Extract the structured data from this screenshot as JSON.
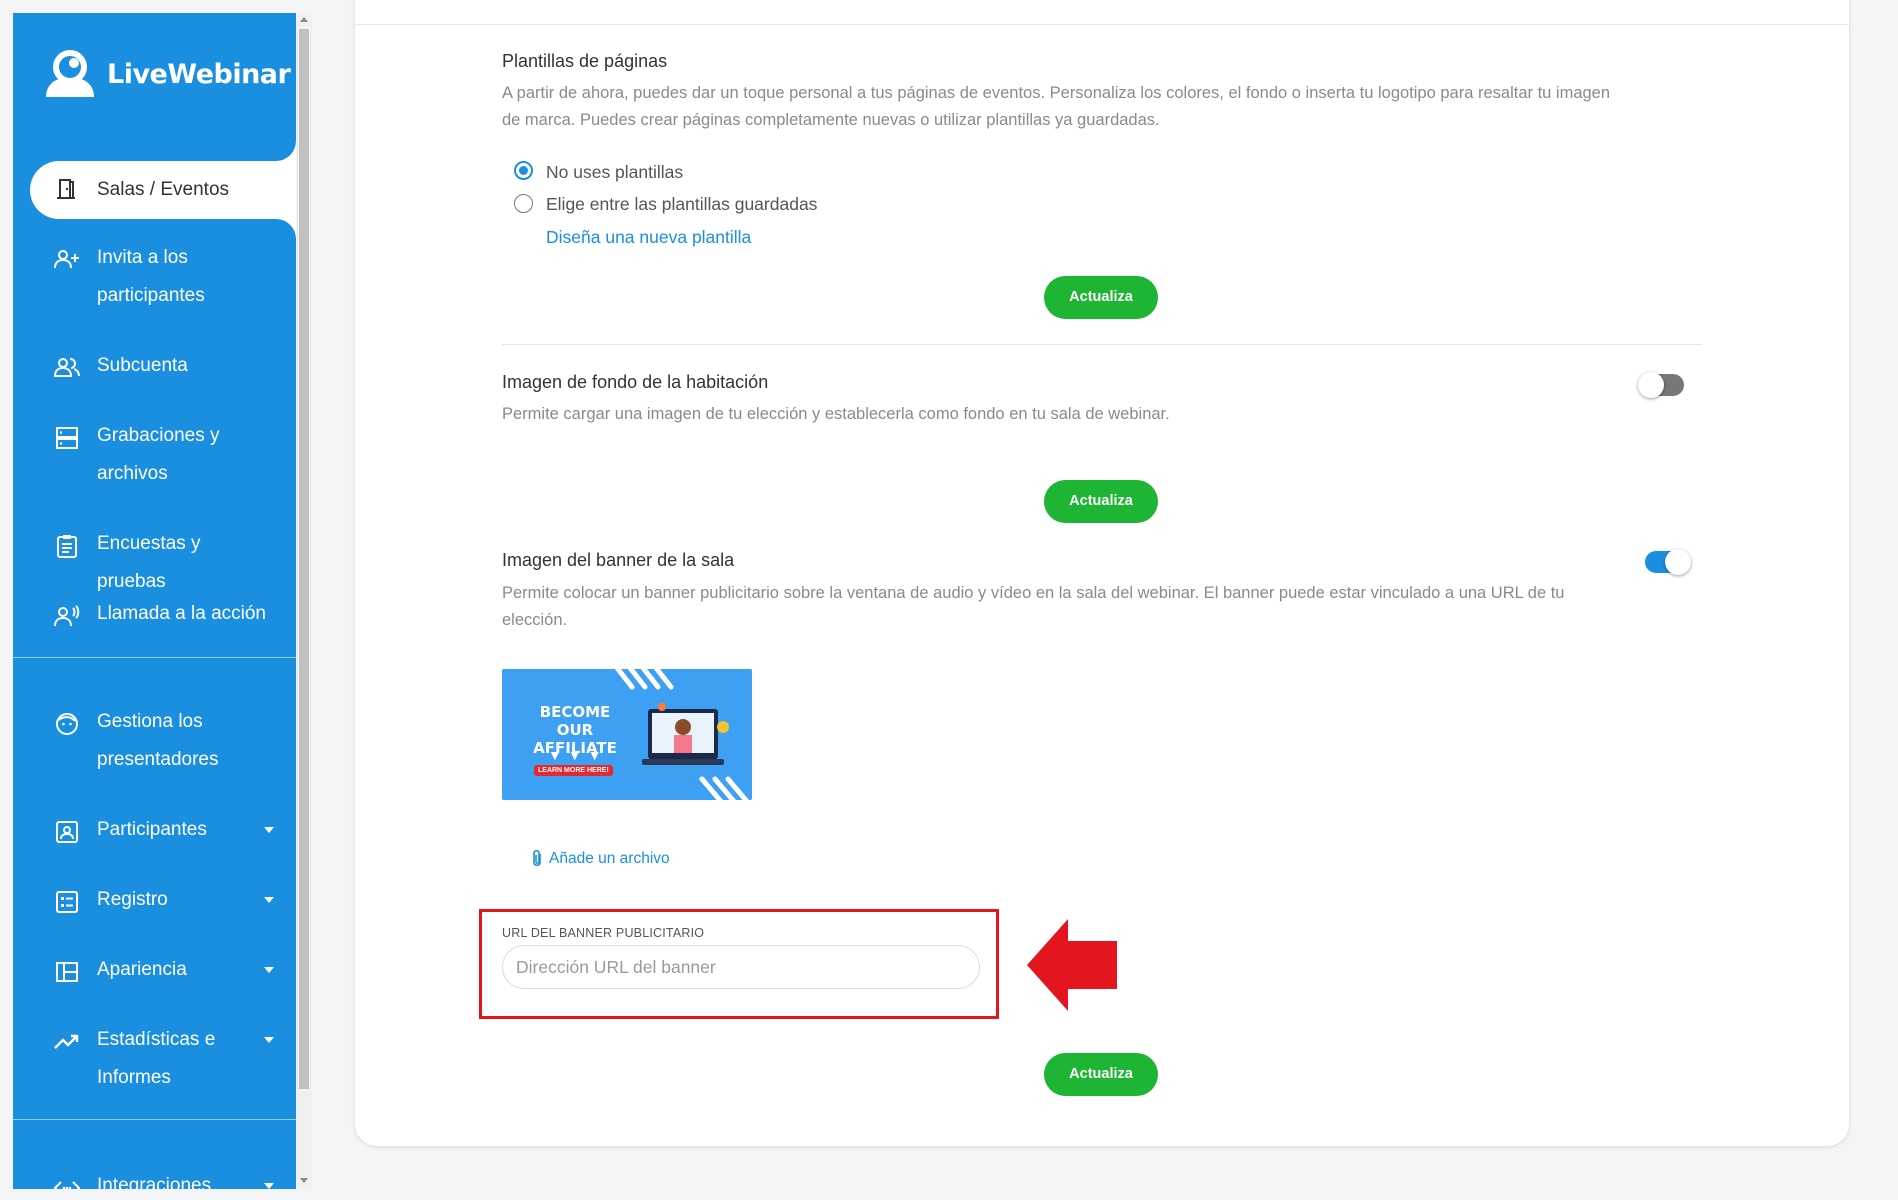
{
  "brand": {
    "name": "LiveWebinar"
  },
  "sidebar": {
    "active": {
      "label": "Salas / Eventos",
      "icon": "door-icon"
    },
    "items": [
      {
        "id": "invite",
        "label": "Invita a los participantes",
        "icon": "add-person-icon",
        "has_caret": false
      },
      {
        "id": "subaccount",
        "label": "Subcuenta",
        "icon": "people-icon",
        "has_caret": false
      },
      {
        "id": "recordings",
        "label": "Grabaciones y archivos",
        "icon": "storage-icon",
        "has_caret": false
      },
      {
        "id": "surveys",
        "label": "Encuestas y pruebas",
        "icon": "clipboard-icon",
        "has_caret": false
      },
      {
        "id": "cta",
        "label": "Llamada a la acción",
        "icon": "speaking-person-icon",
        "has_caret": false
      },
      {
        "id": "presenters",
        "label": "Gestiona los presentadores",
        "icon": "face-icon",
        "has_caret": false
      },
      {
        "id": "participants",
        "label": "Participantes",
        "icon": "contact-card-icon",
        "has_caret": true
      },
      {
        "id": "registration",
        "label": "Registro",
        "icon": "form-icon",
        "has_caret": true
      },
      {
        "id": "appearance",
        "label": "Apariencia",
        "icon": "layout-icon",
        "has_caret": true
      },
      {
        "id": "stats",
        "label": "Estadísticas e Informes",
        "icon": "trending-up-icon",
        "has_caret": true
      },
      {
        "id": "integrations",
        "label": "Integraciones",
        "icon": "code-arrows-icon",
        "has_caret": true
      }
    ]
  },
  "templates": {
    "title": "Plantillas de páginas",
    "description": "A partir de ahora, puedes dar un toque personal a tus páginas de eventos. Personaliza los colores, el fondo o inserta tu logotipo para resaltar tu imagen de marca. Puedes crear páginas completamente nuevas o utilizar plantillas ya guardadas.",
    "options": [
      {
        "label": "No uses plantillas",
        "checked": true
      },
      {
        "label": "Elige entre las plantillas guardadas",
        "checked": false
      }
    ],
    "design_link": "Diseña una nueva plantilla",
    "update_label": "Actualiza"
  },
  "background": {
    "title": "Imagen de fondo de la habitación",
    "description": "Permite cargar una imagen de tu elección y establecerla como fondo en tu sala de webinar.",
    "enabled": false,
    "update_label": "Actualiza"
  },
  "banner": {
    "title": "Imagen del banner de la sala",
    "description": "Permite colocar un banner publicitario sobre la ventana de audio y vídeo en la sala del webinar. El banner puede estar vinculado a una URL de tu elección.",
    "enabled": true,
    "image": {
      "headline": "BECOME OUR AFFILIATE",
      "cta": "LEARN MORE HERE!"
    },
    "attach_label": "Añade un archivo",
    "url_label": "URL DEL BANNER PUBLICITARIO",
    "url_value": "",
    "url_placeholder": "Dirección URL del banner",
    "update_label": "Actualiza"
  },
  "colors": {
    "accent": "#1a8fe0",
    "button": "#1db533",
    "highlight": "#e3161f"
  }
}
